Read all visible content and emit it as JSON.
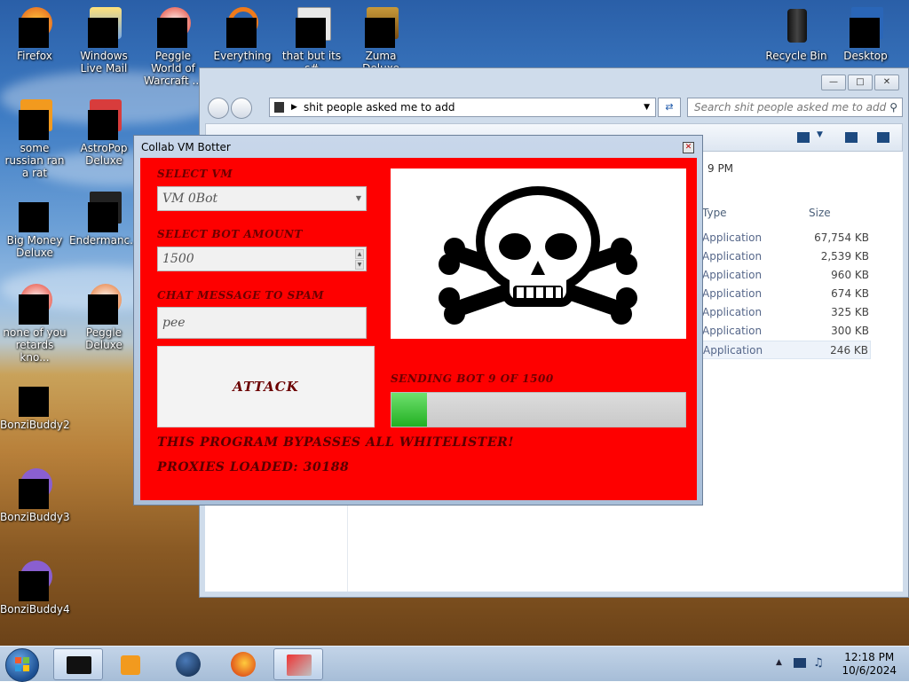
{
  "desktop_icons": [
    {
      "label": "Firefox"
    },
    {
      "label": "Windows Live Mail"
    },
    {
      "label": "Peggle World of Warcraft ..."
    },
    {
      "label": "Everything"
    },
    {
      "label": "that but its c#"
    },
    {
      "label": "Zuma Deluxe"
    },
    {
      "label": "Recycle Bin"
    },
    {
      "label": "Desktop"
    },
    {
      "label": "some russian ran a rat"
    },
    {
      "label": "AstroPop Deluxe"
    },
    {
      "label": "Big Money Deluxe"
    },
    {
      "label": "Endermanc..."
    },
    {
      "label": "none of you retards kno..."
    },
    {
      "label": "Peggle Deluxe"
    },
    {
      "label": "BonziBuddy2"
    },
    {
      "label": "BonziBuddy3"
    },
    {
      "label": "BonziBuddy4"
    }
  ],
  "explorer": {
    "address": "shit people asked me to add",
    "search_placeholder": "Search shit people asked me to add",
    "time_fragment": "9 PM",
    "columns": {
      "type": "Type",
      "size": "Size"
    },
    "rows": [
      {
        "type": "Application",
        "size": "67,754 KB"
      },
      {
        "type": "Application",
        "size": "2,539 KB"
      },
      {
        "type": "Application",
        "size": "960 KB"
      },
      {
        "type": "Application",
        "size": "674 KB"
      },
      {
        "type": "Application",
        "size": "325 KB"
      },
      {
        "type": "Application",
        "size": "300 KB"
      },
      {
        "type": "Application",
        "size": "246 KB"
      }
    ]
  },
  "bot": {
    "title": "Collab VM Botter",
    "select_vm_label": "SELECT VM",
    "select_vm_value": "VM 0Bot",
    "bot_amount_label": "SELECT BOT AMOUNT",
    "bot_amount_value": "1500",
    "chat_label": "CHAT MESSAGE TO SPAM",
    "chat_value": "pee",
    "attack_label": "ATTACK",
    "status": "SENDING BOT 9 OF 1500",
    "progress_fraction": 0.12,
    "bypass_text": "THIS PROGRAM BYPASSES ALL WHITELISTER!",
    "proxies_text": "PROXIES LOADED: 30188"
  },
  "taskbar": {
    "time": "12:18 PM",
    "date": "10/6/2024"
  }
}
